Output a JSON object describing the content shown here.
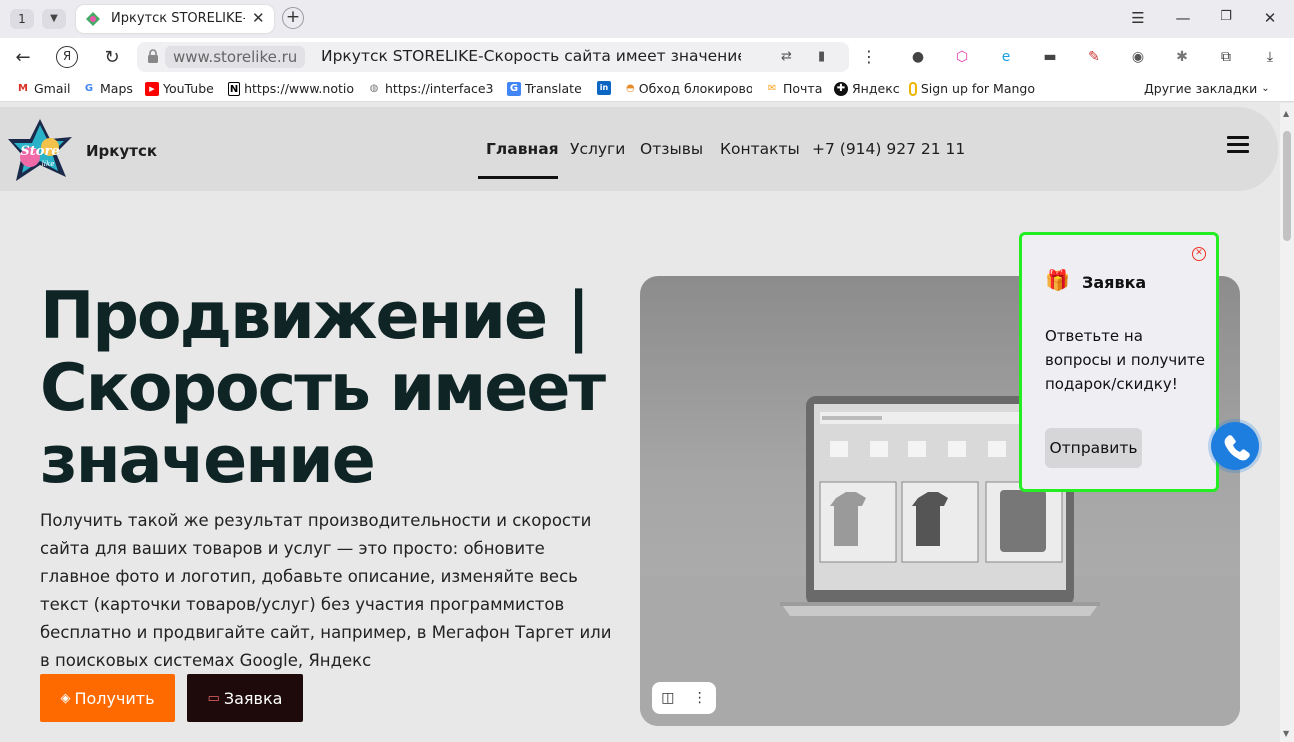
{
  "browser": {
    "tab_count": "1",
    "tab_title": "Иркутск STORELIKE-С",
    "url_host": "www.storelike.ru",
    "url_title": "Иркутск STORELIKE-Скорость сайта имеет значение...",
    "icons": [
      "back-icon",
      "yandex-icon",
      "reload-icon",
      "lock-icon",
      "translate-icon",
      "bookmark-icon",
      "more-icon",
      "minimize-icon",
      "maximize-icon",
      "close-icon",
      "download-icon"
    ]
  },
  "bookmarks": [
    {
      "label": "Gmail",
      "icon": "gmail-icon",
      "color": "#d93025",
      "glyph": "M"
    },
    {
      "label": "Maps",
      "icon": "google-icon",
      "color": "#4285f4",
      "glyph": "G"
    },
    {
      "label": "YouTube",
      "icon": "youtube-icon",
      "color": "#ff0000",
      "glyph": "▶"
    },
    {
      "label": "https://www.notio",
      "icon": "notion-icon",
      "color": "#000000",
      "glyph": "N"
    },
    {
      "label": "https://interface3",
      "icon": "globe-icon",
      "color": "#777777",
      "glyph": "◍"
    },
    {
      "label": "Translate",
      "icon": "translate-icon",
      "color": "#4285f4",
      "glyph": "G"
    },
    {
      "label": "",
      "icon": "linkedin-icon",
      "color": "#0a66c2",
      "glyph": "in"
    },
    {
      "label": "Обход блокирово",
      "icon": "unblock-icon",
      "color": "#e88b2c",
      "glyph": "◓"
    },
    {
      "label": "Почта",
      "icon": "mail-icon",
      "color": "#f5a623",
      "glyph": "✉"
    },
    {
      "label": "Яндекс",
      "icon": "yandex-plus-icon",
      "color": "#111111",
      "glyph": "✚"
    },
    {
      "label": "Sign up for Mango",
      "icon": "mango-icon",
      "color": "#f0b400",
      "glyph": "◯"
    }
  ],
  "other_bookmarks": "Другие закладки",
  "header": {
    "city": "Иркутск",
    "nav": [
      "Главная",
      "Услуги",
      "Отзывы",
      "Контакты",
      "+7 (914) 927 21 11"
    ]
  },
  "hero": {
    "title": "Продвижение | Скорость имеет значение",
    "text": "Получить такой же результат производительности и скорости сайта для ваших товаров и услуг — это просто: обновите главное фото и логотип, добавьте описание, изменяйте весь текст (карточки товаров/услуг) без участия программистов бесплатно и продвигайте сайт, например, в Мегафон Таргет или в поисковых системах Google, Яндекс",
    "btn_get": "Получить",
    "btn_request": "Заявка"
  },
  "popup": {
    "title": "Заявка",
    "text": "Ответьте на вопросы и получите подарок/скидку!",
    "button": "Отправить"
  },
  "colors": {
    "accent_orange": "#ff6a00",
    "dark_button": "#1e0a0a",
    "popup_border": "#22ee22",
    "call_button": "#1e7ee0",
    "title_color": "#0f2424"
  }
}
